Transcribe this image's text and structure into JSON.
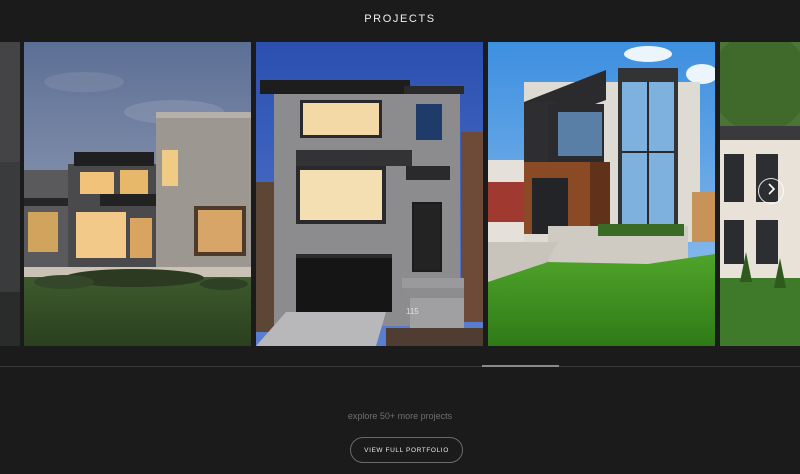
{
  "header": {
    "title": "PROJECTS"
  },
  "carousel": {
    "slides": [
      {
        "name": "partial-left-slide"
      },
      {
        "name": "project-slide-1",
        "subject": "modern home at dusk"
      },
      {
        "name": "project-slide-2",
        "subject": "stone facade with black garage door",
        "house_number": "115"
      },
      {
        "name": "project-slide-3",
        "subject": "dark wood and glass house on lawn"
      },
      {
        "name": "partial-right-slide"
      }
    ],
    "next_icon": "chevron-right-icon"
  },
  "scrollbar": {
    "position": 0.65
  },
  "footer": {
    "explore_text": "explore 50+ more projects",
    "button_label": "VIEW FULL PORTFOLIO"
  },
  "colors": {
    "background": "#1b1b1c",
    "text": "#e8e8e8",
    "muted": "#6f6f72"
  }
}
